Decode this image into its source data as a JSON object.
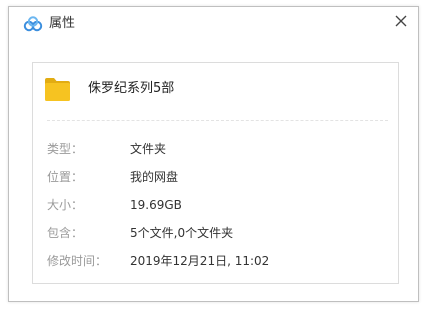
{
  "window": {
    "title": "属性",
    "app_icon": "baidu-netdisk-cloud-icon",
    "close_icon": "close-icon"
  },
  "file": {
    "icon": "folder-icon",
    "name": "侏罗纪系列5部"
  },
  "properties": [
    {
      "label": "类型：",
      "value": "文件夹"
    },
    {
      "label": "位置：",
      "value": "我的网盘"
    },
    {
      "label": "大小：",
      "value": "19.69GB"
    },
    {
      "label": "包含：",
      "value": "5个文件,0个文件夹"
    },
    {
      "label": "修改时间：",
      "value": "2019年12月21日, 11:02"
    }
  ],
  "colors": {
    "folder": "#f6c321",
    "folder_tab": "#e2ac12",
    "cloud_blue": "#3b8ede",
    "label": "#9a9a9a",
    "value": "#333333"
  }
}
